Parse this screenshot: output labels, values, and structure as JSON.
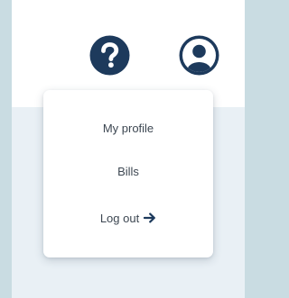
{
  "header": {
    "help_icon": "question-circle-icon",
    "account_icon": "user-avatar-icon",
    "icon_color": "#1d3a5c"
  },
  "menu": {
    "items": [
      {
        "label": "My profile"
      },
      {
        "label": "Bills"
      },
      {
        "label": "Log out",
        "icon": "arrow-right-icon"
      }
    ]
  }
}
